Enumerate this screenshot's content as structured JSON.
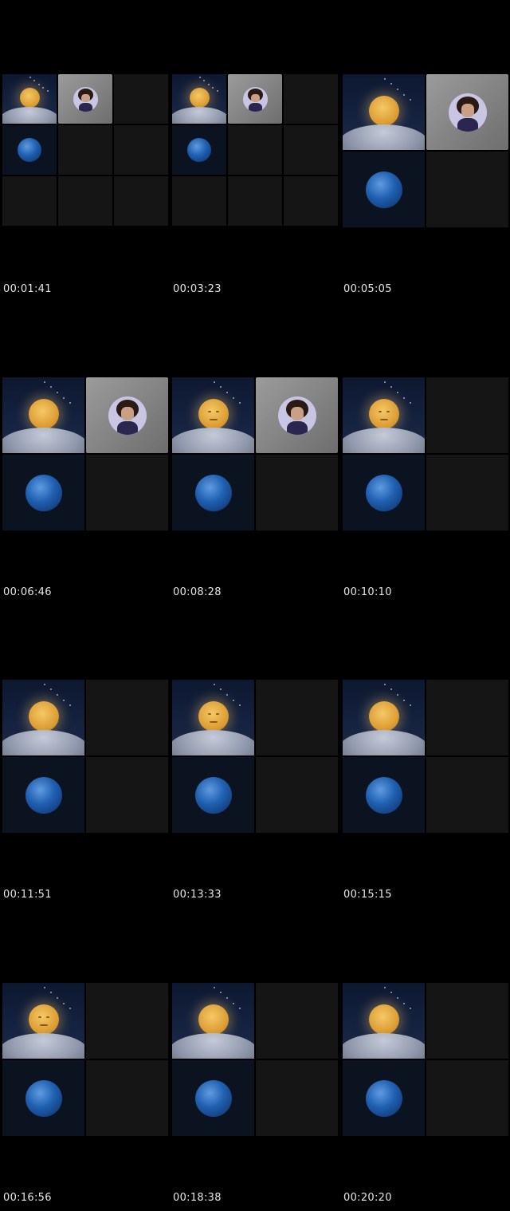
{
  "frames": [
    {
      "timestamp": "00:01:41",
      "layout": "small",
      "avatar": true,
      "moon_face": false
    },
    {
      "timestamp": "00:03:23",
      "layout": "small",
      "avatar": true,
      "moon_face": false
    },
    {
      "timestamp": "00:05:05",
      "layout": "large",
      "avatar": true,
      "moon_face": false
    },
    {
      "timestamp": "00:06:46",
      "layout": "large",
      "avatar": true,
      "moon_face": false
    },
    {
      "timestamp": "00:08:28",
      "layout": "large",
      "avatar": true,
      "moon_face": true
    },
    {
      "timestamp": "00:10:10",
      "layout": "large",
      "avatar": false,
      "moon_face": true
    },
    {
      "timestamp": "00:11:51",
      "layout": "large",
      "avatar": false,
      "moon_face": false
    },
    {
      "timestamp": "00:13:33",
      "layout": "large",
      "avatar": false,
      "moon_face": true
    },
    {
      "timestamp": "00:15:15",
      "layout": "large",
      "avatar": false,
      "moon_face": false
    },
    {
      "timestamp": "00:16:56",
      "layout": "large",
      "avatar": false,
      "moon_face": true
    },
    {
      "timestamp": "00:18:38",
      "layout": "large",
      "avatar": false,
      "moon_face": false
    },
    {
      "timestamp": "00:20:20",
      "layout": "large",
      "avatar": false,
      "moon_face": false
    }
  ],
  "icons": {
    "moon_tile": "moon-over-clouds-icon",
    "earth_tile": "earth-globe-icon",
    "avatar_tile": "user-avatar-icon"
  }
}
